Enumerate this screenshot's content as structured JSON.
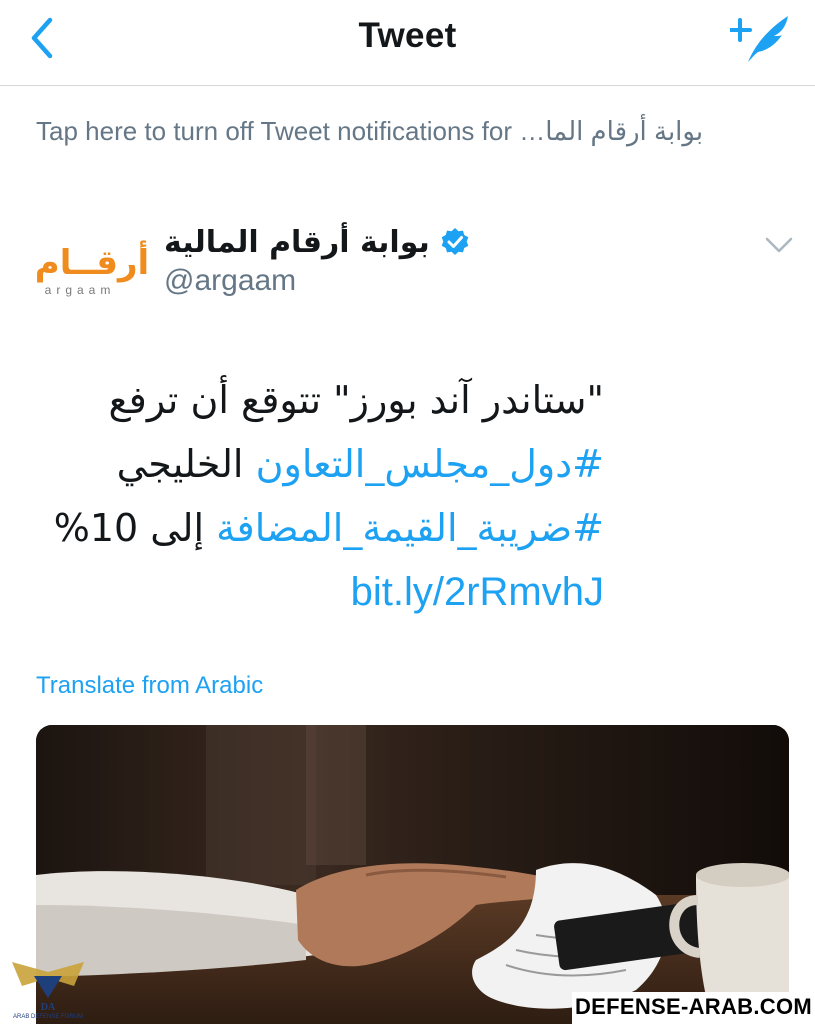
{
  "header": {
    "title": "Tweet",
    "back_icon": "chevron-left-icon",
    "compose_icon": "compose-tweet-icon",
    "accent_color": "#1da1f2"
  },
  "notification": {
    "text_en": "Tap here to turn off Tweet notifications for",
    "text_ar": "بوابة أرقام الما…"
  },
  "tweet": {
    "author": {
      "display_name": "بوابة أرقام المالية",
      "handle": "@argaam",
      "verified": true,
      "avatar_text_ar": "أرقــام",
      "avatar_text_en": "argaam"
    },
    "body": {
      "line1": "\"ستاندر آند بورز\" تتوقع أن ترفع",
      "hashtag1": "#دول_مجلس_التعاون",
      "line2_rest": "الخليجي",
      "hashtag2": "#ضريبة_القيمة_المضافة",
      "line3_rest": "إلى 10%",
      "link": "bit.ly/2rRmvhJ"
    },
    "translate_label": "Translate from Arabic"
  },
  "watermark": {
    "site": "DEFENSE-ARAB.COM",
    "logo_text": "DA",
    "logo_caption": "ARAB DEFENSE FORUM"
  }
}
